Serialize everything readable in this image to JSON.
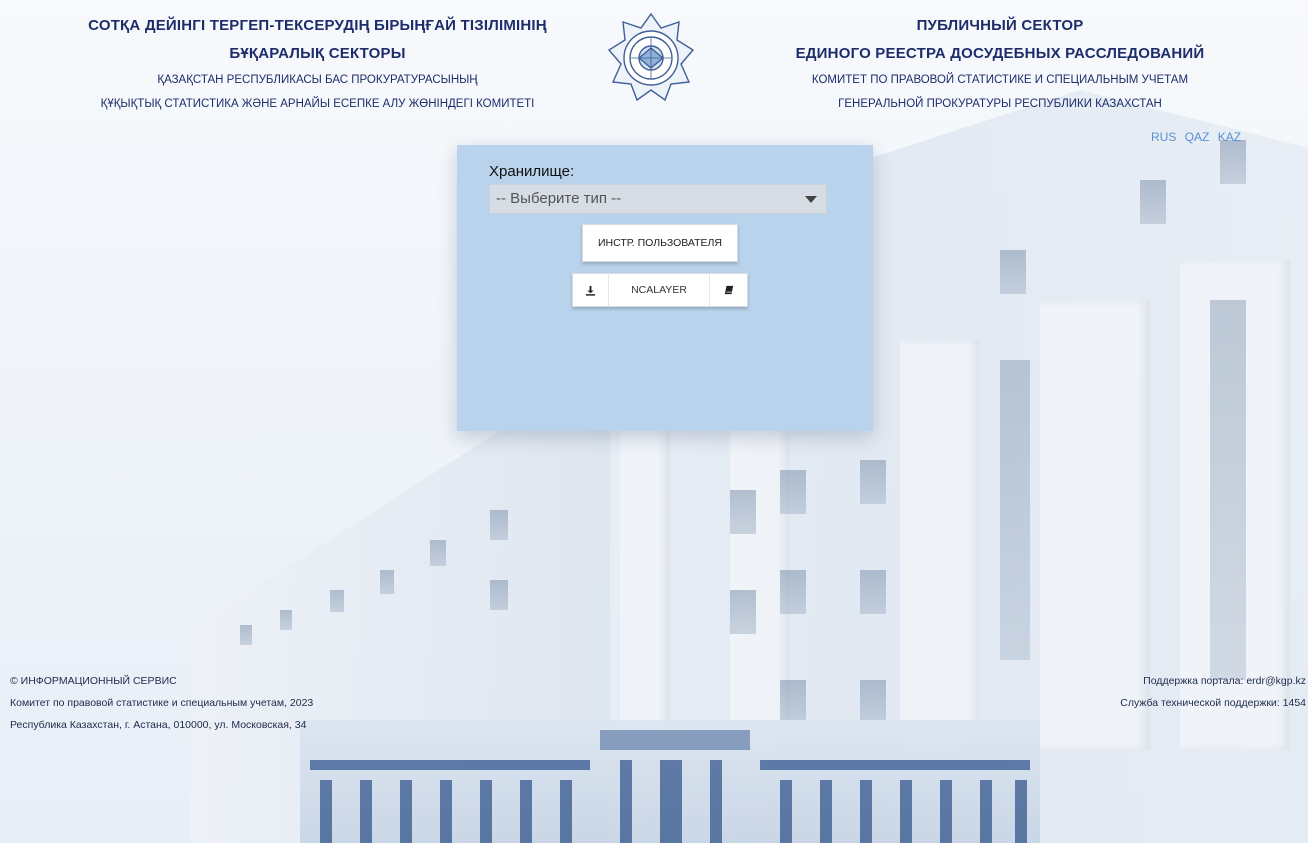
{
  "header": {
    "left": {
      "title_line1": "СОТҚА ДЕЙІНГІ ТЕРГЕП-ТЕКСЕРУДІҢ БІРЫҢҒАЙ ТІЗІЛІМІНІҢ",
      "title_line2": "БҰҚАРАЛЫҚ СЕКТОРЫ",
      "sub_line1": "ҚАЗАҚСТАН РЕСПУБЛИКАСЫ БАС ПРОКУРАТУРАСЫНЫҢ",
      "sub_line2": "ҚҰҚЫҚТЫҚ СТАТИСТИКА ЖӘНЕ АРНАЙЫ ЕСЕПКЕ АЛУ ЖӨНІНДЕГІ КОМИТЕТІ"
    },
    "right": {
      "title_line1": "ПУБЛИЧНЫЙ СЕКТОР",
      "title_line2": "ЕДИНОГО РЕЕСТРА ДОСУДЕБНЫХ РАССЛЕДОВАНИЙ",
      "sub_line1": "КОМИТЕТ ПО ПРАВОВОЙ СТАТИСТИКЕ И СПЕЦИАЛЬНЫМ УЧЕТАМ",
      "sub_line2": "ГЕНЕРАЛЬНОЙ ПРОКУРАТУРЫ РЕСПУБЛИКИ КАЗАХСТАН"
    },
    "emblem_icon": "prosecutor-emblem-icon",
    "languages": [
      "RUS",
      "QAZ",
      "KAZ"
    ]
  },
  "login": {
    "storage_label": "Хранилище:",
    "storage_select_value": "-- Выберите тип --",
    "guide_button": "ИНСТР. ПОЛЬЗОВАТЕЛЯ",
    "ncalayer_label": "NCALAYER",
    "download_icon": "download-icon",
    "book_icon": "book-icon"
  },
  "footer": {
    "left": [
      "© ИНФОРМАЦИОННЫЙ СЕРВИС",
      "Комитет по правовой статистике и специальным учетам, 2023",
      "Республика Казахстан, г. Астана, 010000, ул. Московская, 34"
    ],
    "right": [
      "Поддержка портала: erdr@kgp.kz",
      "Служба технической поддержки: 1454"
    ]
  },
  "colors": {
    "panel": "#b9d3ec",
    "header_text": "#1d2d6b",
    "lang_link": "#5b8fd1",
    "select_bg": "#d6dde5"
  }
}
